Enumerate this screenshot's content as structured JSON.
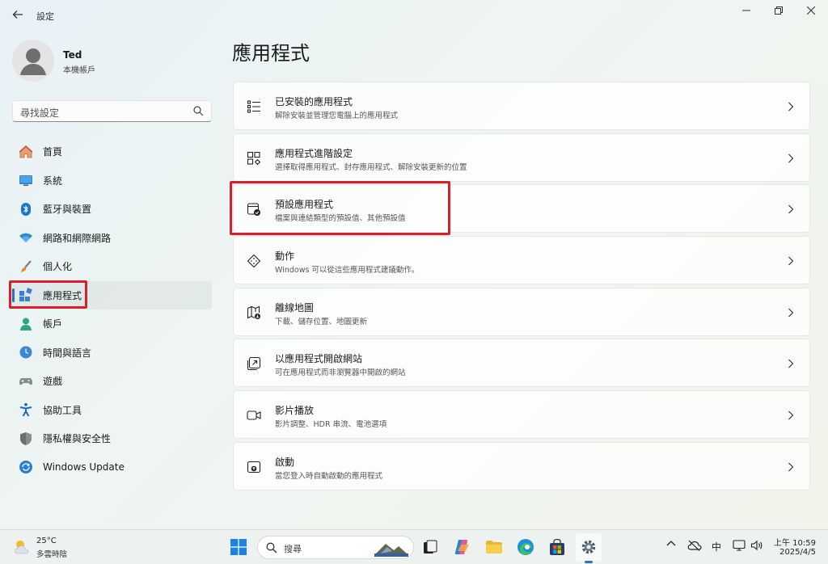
{
  "window": {
    "title": "設定"
  },
  "profile": {
    "name": "Ted",
    "account_type": "本機帳戶"
  },
  "search": {
    "placeholder": "尋找設定"
  },
  "sidebar": {
    "items": [
      {
        "label": "首頁",
        "icon": "home-icon"
      },
      {
        "label": "系統",
        "icon": "system-icon"
      },
      {
        "label": "藍牙與裝置",
        "icon": "bluetooth-icon"
      },
      {
        "label": "網路和網際網路",
        "icon": "wifi-icon"
      },
      {
        "label": "個人化",
        "icon": "brush-icon"
      },
      {
        "label": "應用程式",
        "icon": "apps-icon",
        "active": true
      },
      {
        "label": "帳戶",
        "icon": "account-icon"
      },
      {
        "label": "時間與語言",
        "icon": "time-language-icon"
      },
      {
        "label": "遊戲",
        "icon": "gamepad-icon"
      },
      {
        "label": "協助工具",
        "icon": "accessibility-icon"
      },
      {
        "label": "隱私權與安全性",
        "icon": "shield-icon"
      },
      {
        "label": "Windows Update",
        "icon": "update-icon"
      }
    ]
  },
  "main": {
    "title": "應用程式",
    "cards": [
      {
        "title": "已安裝的應用程式",
        "desc": "解除安裝並管理您電腦上的應用程式",
        "icon": "installed-apps-icon"
      },
      {
        "title": "應用程式進階設定",
        "desc": "選擇取得應用程式、封存應用程式、解除安裝更新的位置",
        "icon": "advanced-apps-icon"
      },
      {
        "title": "預設應用程式",
        "desc": "檔案與連結類型的預設值、其他預設值",
        "icon": "default-apps-icon"
      },
      {
        "title": "動作",
        "desc": "Windows 可以從這些應用程式建議動作。",
        "icon": "actions-icon"
      },
      {
        "title": "離線地圖",
        "desc": "下載、儲存位置、地圖更新",
        "icon": "offline-maps-icon"
      },
      {
        "title": "以應用程式開啟網站",
        "desc": "可在應用程式而非瀏覽器中開啟的網站",
        "icon": "open-website-icon"
      },
      {
        "title": "影片播放",
        "desc": "影片調整、HDR 串流、電池選項",
        "icon": "video-icon"
      },
      {
        "title": "啟動",
        "desc": "當您登入時自動啟動的應用程式",
        "icon": "startup-icon"
      }
    ]
  },
  "taskbar": {
    "weather_temp": "25°C",
    "weather_desc": "多雲時陰",
    "search_label": "搜尋",
    "ime": "中",
    "time": "上午 10:59",
    "date": "2025/4/5"
  },
  "colors": {
    "accent": "#2b6fc4",
    "highlight": "#d7202a"
  }
}
